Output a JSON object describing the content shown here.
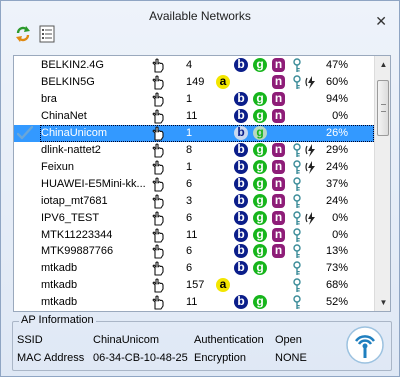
{
  "window": {
    "title": "Available Networks",
    "close_glyph": "✕"
  },
  "toolbar": {
    "refresh_icon": "refresh-icon",
    "listview_icon": "list-view-icon"
  },
  "colors": {
    "selected_row": "#3399ff",
    "badge_a": "#f3e600",
    "badge_b": "#0b1e8a",
    "badge_g": "#17b51c",
    "badge_n": "#8e1d78"
  },
  "networks": [
    {
      "ssid": "BELKIN2.4G",
      "channel": "4",
      "a": false,
      "b": true,
      "g": true,
      "n": true,
      "locked": true,
      "extra": "none",
      "signal": "47%"
    },
    {
      "ssid": "BELKIN5G",
      "channel": "149",
      "a": true,
      "b": false,
      "g": false,
      "n": true,
      "locked": true,
      "extra": "wps",
      "signal": "60%"
    },
    {
      "ssid": "bra",
      "channel": "1",
      "a": false,
      "b": true,
      "g": true,
      "n": true,
      "locked": false,
      "extra": "none",
      "signal": "94%"
    },
    {
      "ssid": "ChinaNet",
      "channel": "11",
      "a": false,
      "b": true,
      "g": true,
      "n": true,
      "locked": false,
      "extra": "none",
      "signal": "0%"
    },
    {
      "ssid": "ChinaUnicom",
      "channel": "1",
      "a": false,
      "b": true,
      "g": true,
      "n": false,
      "locked": false,
      "extra": "none",
      "signal": "26%",
      "selected": true,
      "connected": true
    },
    {
      "ssid": "dlink-nattet2",
      "channel": "8",
      "a": false,
      "b": true,
      "g": true,
      "n": true,
      "locked": true,
      "extra": "wps",
      "signal": "29%"
    },
    {
      "ssid": "Feixun",
      "channel": "1",
      "a": false,
      "b": true,
      "g": true,
      "n": true,
      "locked": true,
      "extra": "wps",
      "signal": "24%"
    },
    {
      "ssid": "HUAWEI-E5Mini-kk...",
      "channel": "6",
      "a": false,
      "b": true,
      "g": true,
      "n": true,
      "locked": true,
      "extra": "none",
      "signal": "37%"
    },
    {
      "ssid": "iotap_mt7681",
      "channel": "3",
      "a": false,
      "b": true,
      "g": true,
      "n": true,
      "locked": true,
      "extra": "none",
      "signal": "24%"
    },
    {
      "ssid": "IPV6_TEST",
      "channel": "6",
      "a": false,
      "b": true,
      "g": true,
      "n": true,
      "locked": true,
      "extra": "wps",
      "signal": "0%"
    },
    {
      "ssid": "MTK11223344",
      "channel": "11",
      "a": false,
      "b": true,
      "g": true,
      "n": true,
      "locked": true,
      "extra": "none",
      "signal": "0%"
    },
    {
      "ssid": "MTK99887766",
      "channel": "6",
      "a": false,
      "b": true,
      "g": true,
      "n": true,
      "locked": true,
      "extra": "none",
      "signal": "13%"
    },
    {
      "ssid": "mtkadb",
      "channel": "6",
      "a": false,
      "b": true,
      "g": true,
      "n": false,
      "locked": true,
      "extra": "none",
      "signal": "73%"
    },
    {
      "ssid": "mtkadb",
      "channel": "157",
      "a": true,
      "b": false,
      "g": false,
      "n": false,
      "locked": true,
      "extra": "none",
      "signal": "68%"
    },
    {
      "ssid": "mtkadb",
      "channel": "11",
      "a": false,
      "b": true,
      "g": true,
      "n": false,
      "locked": true,
      "extra": "none",
      "signal": "52%"
    }
  ],
  "ap_info": {
    "legend": "AP Information",
    "ssid_label": "SSID",
    "ssid_value": "ChinaUnicom",
    "mac_label": "MAC Address",
    "mac_value": "06-34-CB-10-48-25",
    "auth_label": "Authentication",
    "auth_value": "Open",
    "enc_label": "Encryption",
    "enc_value": "NONE"
  }
}
